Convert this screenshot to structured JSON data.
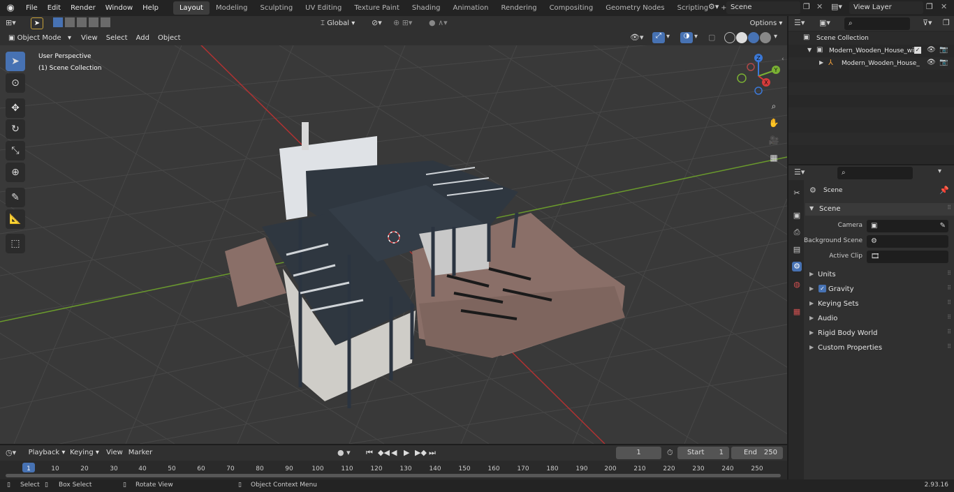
{
  "menubar": {
    "items": [
      "File",
      "Edit",
      "Render",
      "Window",
      "Help"
    ],
    "workspaces": [
      "Layout",
      "Modeling",
      "Sculpting",
      "UV Editing",
      "Texture Paint",
      "Shading",
      "Animation",
      "Rendering",
      "Compositing",
      "Geometry Nodes",
      "Scripting"
    ],
    "active_workspace": "Layout",
    "add_tab": "+",
    "scene_field": "Scene",
    "viewlayer_field": "View Layer"
  },
  "viewport_header": {
    "transform_orientation": "Global",
    "options_label": "Options",
    "mode": "Object Mode",
    "menus": [
      "View",
      "Select",
      "Add",
      "Object"
    ]
  },
  "viewport": {
    "overlay_view_name": "User Perspective",
    "overlay_collection": "(1) Scene Collection",
    "gizmo": {
      "x_label": "X",
      "y_label": "Y",
      "z_label": "Z"
    }
  },
  "outliner": {
    "root": "Scene Collection",
    "items": [
      {
        "label": "Modern_Wooden_House_with",
        "indent": 1
      },
      {
        "label": "Modern_Wooden_House_",
        "indent": 2
      }
    ]
  },
  "properties": {
    "context": "Scene",
    "panel_title": "Scene",
    "fields": [
      {
        "label": "Camera",
        "value": ""
      },
      {
        "label": "Background Scene",
        "value": ""
      },
      {
        "label": "Active Clip",
        "value": ""
      }
    ],
    "subpanels": [
      "Units",
      "Gravity",
      "Keying Sets",
      "Audio",
      "Rigid Body World",
      "Custom Properties"
    ],
    "gravity_checked": true
  },
  "timeline": {
    "menus": [
      "Playback",
      "Keying",
      "View",
      "Marker"
    ],
    "current_frame": "1",
    "start_label": "Start",
    "start_value": "1",
    "end_label": "End",
    "end_value": "250",
    "ruler": [
      "1",
      "10",
      "20",
      "30",
      "40",
      "50",
      "60",
      "70",
      "80",
      "90",
      "100",
      "110",
      "120",
      "130",
      "140",
      "150",
      "160",
      "170",
      "180",
      "190",
      "200",
      "210",
      "220",
      "230",
      "240",
      "250"
    ]
  },
  "statusbar": {
    "select": "Select",
    "box_select": "Box Select",
    "rotate_view": "Rotate View",
    "context_menu": "Object Context Menu",
    "version": "2.93.16"
  },
  "colors": {
    "accent": "#4772b3",
    "x_axis": "#d73b3b",
    "y_axis": "#7ab033",
    "z_axis": "#3b78d7"
  }
}
